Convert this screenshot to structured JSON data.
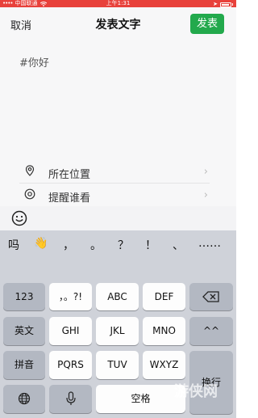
{
  "status_bar": {
    "carrier": "中国联通",
    "time": "上午1:31"
  },
  "nav": {
    "cancel_label": "取消",
    "title": "发表文字",
    "publish_label": "发表"
  },
  "editor": {
    "text": "#你好"
  },
  "options": [
    {
      "label": "所在位置",
      "icon": "location-pin-icon"
    },
    {
      "label": "提醒谁看",
      "icon": "at-icon"
    }
  ],
  "emoji_button": {
    "icon": "smiley-icon"
  },
  "keyboard": {
    "candidates": [
      "吗",
      "👋",
      "，",
      "。",
      "？",
      "！",
      "、",
      "……"
    ],
    "rows": [
      {
        "keys": [
          "123",
          "，。?!",
          "ABC",
          "DEF",
          "delete-icon"
        ]
      },
      {
        "keys": [
          "英文",
          "GHI",
          "JKL",
          "MNO",
          "^^"
        ]
      },
      {
        "keys": [
          "拼音",
          "PQRS",
          "TUV",
          "WXYZ",
          "换行"
        ]
      },
      {
        "keys": [
          "globe-icon",
          "mic-icon",
          "空格"
        ]
      }
    ],
    "key_labels": {
      "num": "123",
      "punct": "，。?!",
      "abc": "ABC",
      "def": "DEF",
      "english": "英文",
      "ghi": "GHI",
      "jkl": "JKL",
      "mno": "MNO",
      "caret": "^^",
      "pinyin": "拼音",
      "pqrs": "PQRS",
      "tuv": "TUV",
      "wxyz": "WXYZ",
      "return": "换行",
      "space": "空格"
    }
  },
  "watermark": "游侠网",
  "colors": {
    "status_bar": "#e8413b",
    "publish_button": "#22a94c",
    "keyboard_bg": "#cfd2d9"
  }
}
